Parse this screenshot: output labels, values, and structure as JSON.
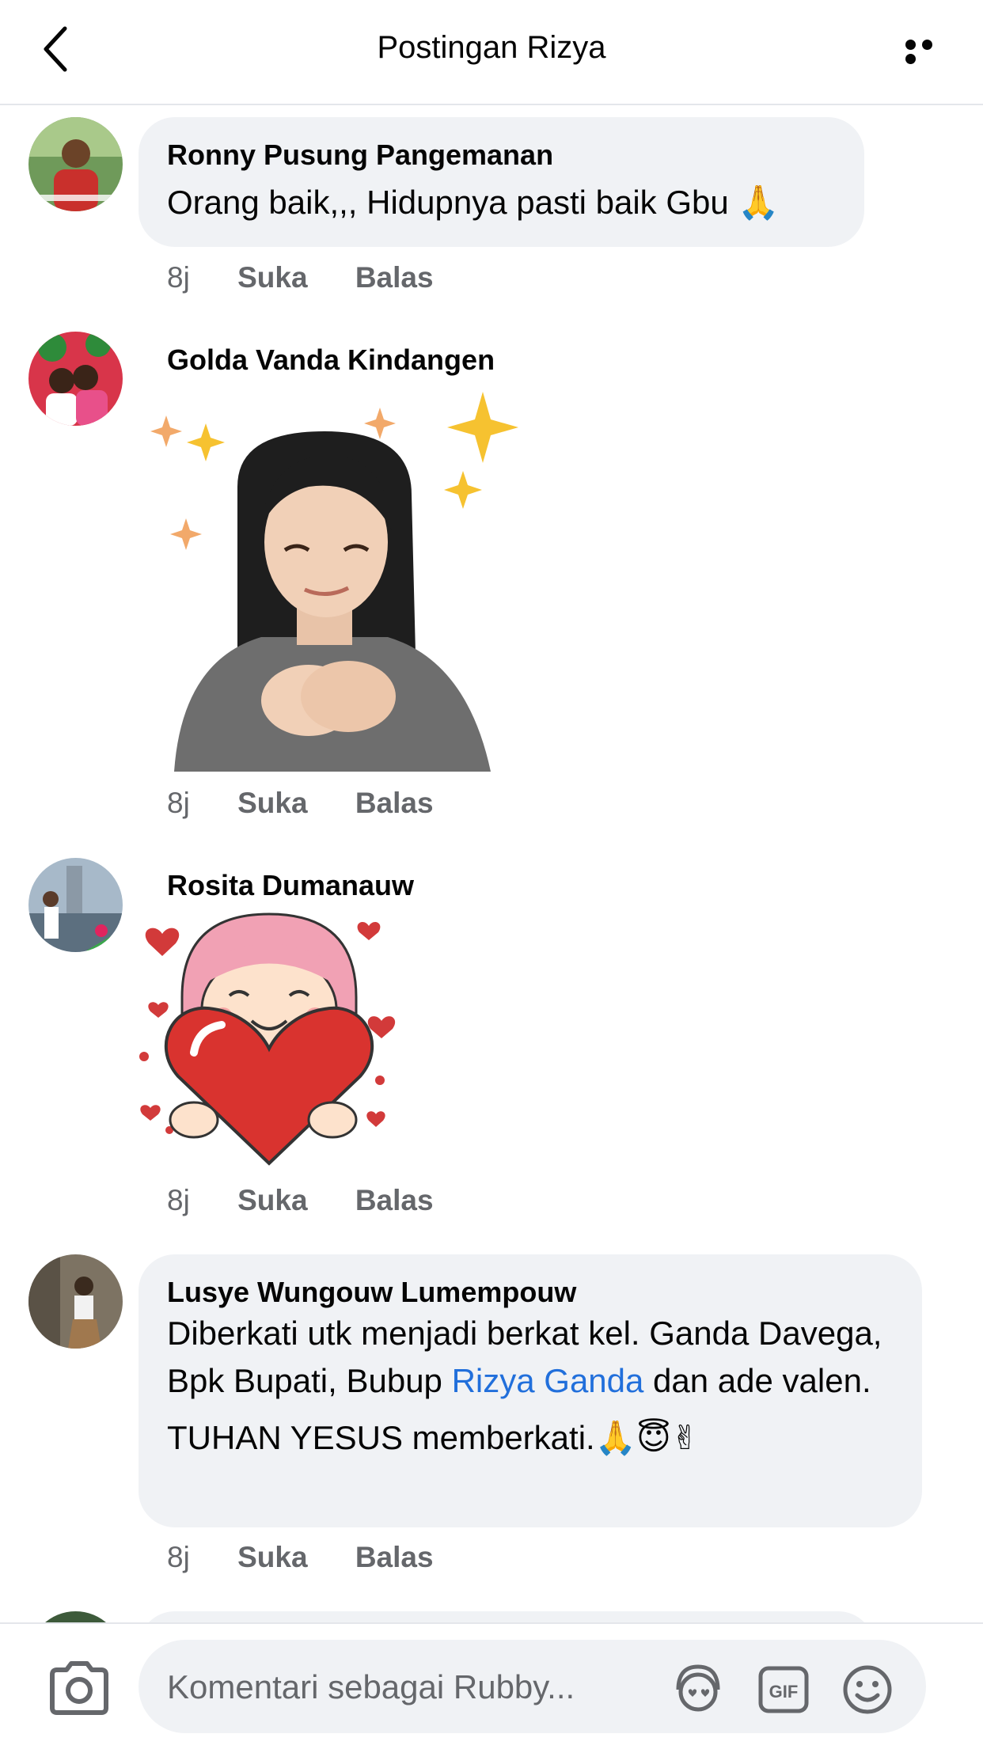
{
  "header": {
    "title": "Postingan Rizya"
  },
  "comments": [
    {
      "author": "Ronny Pusung Pangemanan",
      "text": "Orang baik,,, Hidupnya pasti baik Gbu 🙏",
      "time": "8j",
      "like": "Suka",
      "reply": "Balas"
    },
    {
      "author": "Golda Vanda Kindangen",
      "sticker": "avatar-sticker-hands-on-heart",
      "time": "8j",
      "like": "Suka",
      "reply": "Balas"
    },
    {
      "author": "Rosita Dumanauw",
      "sticker": "girl-holding-heart-sticker",
      "time": "8j",
      "like": "Suka",
      "reply": "Balas"
    },
    {
      "author": "Lusye Wungouw Lumempouw",
      "text_before": "Diberkati utk menjadi berkat kel. Ganda Davega, Bpk Bupati, Bubup ",
      "mention": "Rizya Ganda",
      "text_after": " dan ade valen.",
      "text_line2": "TUHAN YESUS memberkati.🙏😇✌",
      "time": "8j",
      "like": "Suka",
      "reply": "Balas"
    }
  ],
  "composer": {
    "placeholder": "Komentari sebagai Rubby...",
    "icons": [
      "camera-icon",
      "avatar-sticker-icon",
      "gif-icon",
      "emoji-icon"
    ],
    "gif_label": "GIF"
  },
  "colors": {
    "link": "#216fdb",
    "bubble": "#f0f2f5",
    "meta": "#65676b"
  }
}
